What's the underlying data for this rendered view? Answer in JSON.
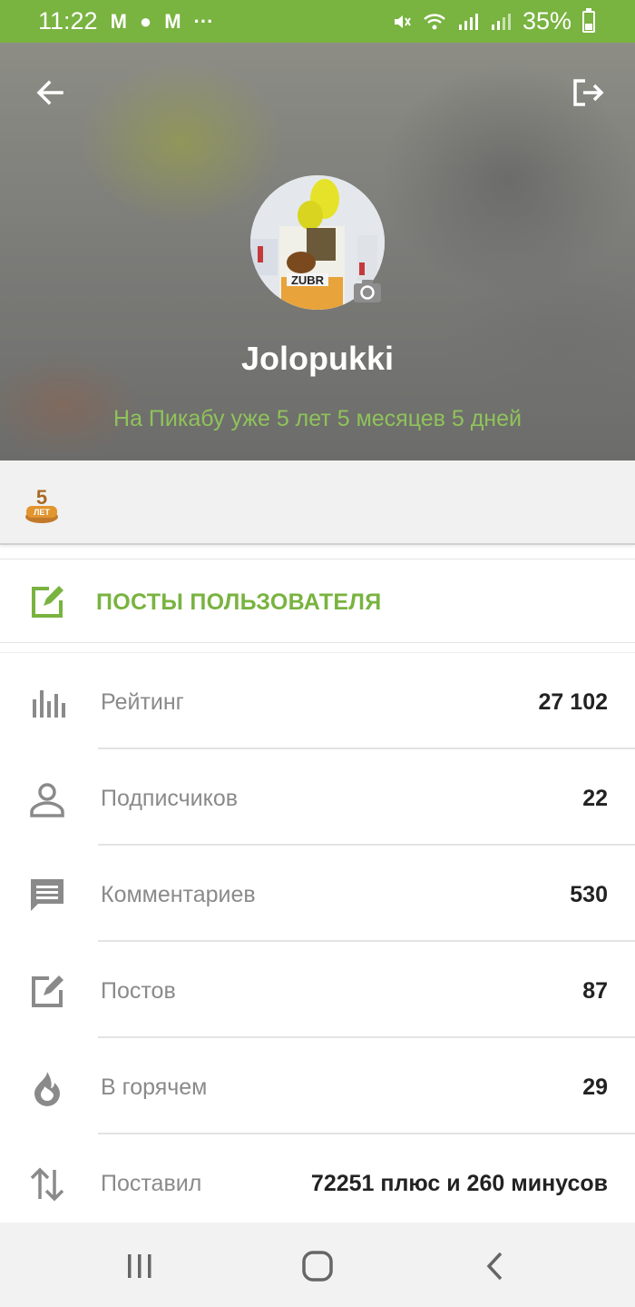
{
  "status_bar": {
    "time": "11:22",
    "notif_icons": [
      "M",
      "●",
      "M",
      "···"
    ],
    "battery": "35%"
  },
  "header": {
    "back_icon": "arrow-left-icon",
    "logout_icon": "logout-icon"
  },
  "profile": {
    "username": "Jolopukki",
    "member_since": "На Пикабу уже 5 лет 5 месяцев 5 дней",
    "avatar_text": "ZUBR"
  },
  "awards": {
    "badge_number": "5",
    "badge_text": "ЛЕТ"
  },
  "posts_card": {
    "label": "ПОСТЫ ПОЛЬЗОВАТЕЛЯ"
  },
  "stats": [
    {
      "icon": "bar-chart-icon",
      "label": "Рейтинг",
      "value": "27 102"
    },
    {
      "icon": "person-icon",
      "label": "Подписчиков",
      "value": "22"
    },
    {
      "icon": "comment-icon",
      "label": "Комментариев",
      "value": "530"
    },
    {
      "icon": "edit-icon",
      "label": "Постов",
      "value": "87"
    },
    {
      "icon": "fire-icon",
      "label": "В горячем",
      "value": "29"
    },
    {
      "icon": "swap-vertical-icon",
      "label": "Поставил",
      "value": "72251 плюс и 260 минусов"
    }
  ],
  "colors": {
    "accent": "#79b340",
    "member_since": "#8fc35a",
    "label_grey": "#8a8a8a"
  }
}
